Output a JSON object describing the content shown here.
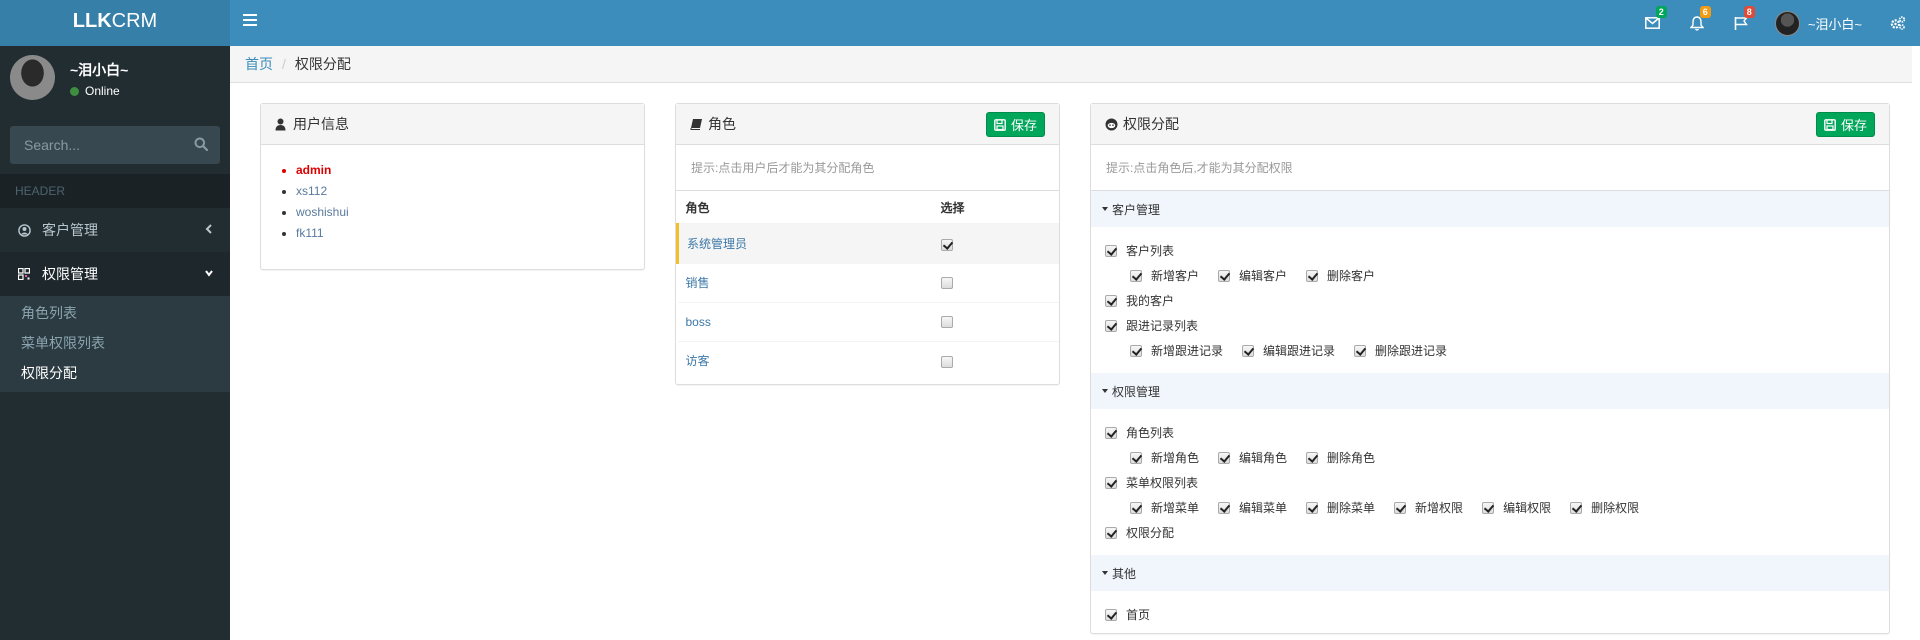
{
  "app": {
    "logo_bold": "LLK",
    "logo_light": "CRM"
  },
  "header": {
    "notifications": [
      {
        "icon": "envelope-icon",
        "count": "2",
        "color": "#00a65a"
      },
      {
        "icon": "bell-icon",
        "count": "6",
        "color": "#f39c12"
      },
      {
        "icon": "flag-icon",
        "count": "8",
        "color": "#dd4b39"
      }
    ],
    "user_name": "~泪小白~"
  },
  "sidebar": {
    "user_name": "~泪小白~",
    "status": "Online",
    "search_placeholder": "Search...",
    "section_header": "HEADER",
    "menu": [
      {
        "label": "客户管理",
        "icon": "user-circle-icon",
        "expanded": false
      },
      {
        "label": "权限管理",
        "icon": "qrcode-icon",
        "expanded": true,
        "children": [
          {
            "label": "角色列表",
            "active": false
          },
          {
            "label": "菜单权限列表",
            "active": false
          },
          {
            "label": "权限分配",
            "active": true
          }
        ]
      }
    ]
  },
  "breadcrumb": {
    "home": "首页",
    "current": "权限分配"
  },
  "user_panel": {
    "title": "用户信息",
    "users": [
      "admin",
      "xs112",
      "woshishui",
      "fk111"
    ],
    "selected": "admin"
  },
  "role_panel": {
    "title": "角色",
    "save_label": "保存",
    "hint": "提示:点击用户后才能为其分配角色",
    "columns": [
      "角色",
      "选择"
    ],
    "rows": [
      {
        "name": "系统管理员",
        "checked": true,
        "selected": true
      },
      {
        "name": "销售",
        "checked": false,
        "selected": false
      },
      {
        "name": "boss",
        "checked": false,
        "selected": false
      },
      {
        "name": "访客",
        "checked": false,
        "selected": false
      }
    ]
  },
  "perm_panel": {
    "title": "权限分配",
    "save_label": "保存",
    "hint": "提示:点击角色后,才能为其分配权限",
    "groups": [
      {
        "name": "客户管理",
        "rows": [
          {
            "type": "main",
            "items": [
              {
                "label": "客户列表",
                "checked": true
              }
            ]
          },
          {
            "type": "sub",
            "items": [
              {
                "label": "新增客户",
                "checked": true
              },
              {
                "label": "编辑客户",
                "checked": true
              },
              {
                "label": "删除客户",
                "checked": true
              }
            ]
          },
          {
            "type": "main",
            "items": [
              {
                "label": "我的客户",
                "checked": true
              }
            ]
          },
          {
            "type": "main",
            "items": [
              {
                "label": "跟进记录列表",
                "checked": true
              }
            ]
          },
          {
            "type": "sub",
            "items": [
              {
                "label": "新增跟进记录",
                "checked": true
              },
              {
                "label": "编辑跟进记录",
                "checked": true
              },
              {
                "label": "删除跟进记录",
                "checked": true
              }
            ]
          }
        ]
      },
      {
        "name": "权限管理",
        "rows": [
          {
            "type": "main",
            "items": [
              {
                "label": "角色列表",
                "checked": true
              }
            ]
          },
          {
            "type": "sub",
            "items": [
              {
                "label": "新增角色",
                "checked": true
              },
              {
                "label": "编辑角色",
                "checked": true
              },
              {
                "label": "删除角色",
                "checked": true
              }
            ]
          },
          {
            "type": "main",
            "items": [
              {
                "label": "菜单权限列表",
                "checked": true
              }
            ]
          },
          {
            "type": "sub",
            "items": [
              {
                "label": "新增菜单",
                "checked": true
              },
              {
                "label": "编辑菜单",
                "checked": true
              },
              {
                "label": "删除菜单",
                "checked": true
              },
              {
                "label": "新增权限",
                "checked": true
              },
              {
                "label": "编辑权限",
                "checked": true
              },
              {
                "label": "删除权限",
                "checked": true
              }
            ]
          },
          {
            "type": "main",
            "items": [
              {
                "label": "权限分配",
                "checked": true
              }
            ]
          }
        ]
      },
      {
        "name": "其他",
        "rows": [
          {
            "type": "main",
            "items": [
              {
                "label": "首页",
                "checked": true
              }
            ]
          }
        ]
      }
    ]
  }
}
